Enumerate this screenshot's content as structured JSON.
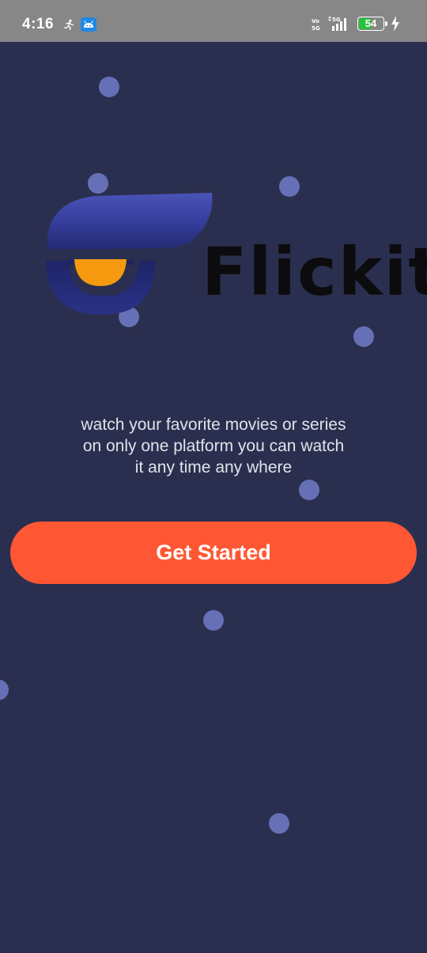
{
  "status_bar": {
    "time": "4:16",
    "network": "5G",
    "network_tag": "Vo 5G",
    "battery_level": "54",
    "battery_fraction": 0.54,
    "icons": [
      "activity-icon",
      "app-notification-icon",
      "volte-icon",
      "signal-icon",
      "battery-icon",
      "charging-icon"
    ]
  },
  "logo": {
    "wordmark": "Flickit",
    "colors": {
      "brand_blue": "#2e3690",
      "brand_orange": "#f59a0e",
      "wordmark": "#0c0c0f"
    }
  },
  "tagline": {
    "lines": [
      "watch your favorite movies or series",
      "on only one platform you can watch",
      "it any time any where"
    ]
  },
  "cta": {
    "label": "Get Started"
  },
  "colors": {
    "background": "#2b2f4f",
    "dots": "#6670b6",
    "cta": "#ff5733",
    "status_bar": "#878787"
  }
}
